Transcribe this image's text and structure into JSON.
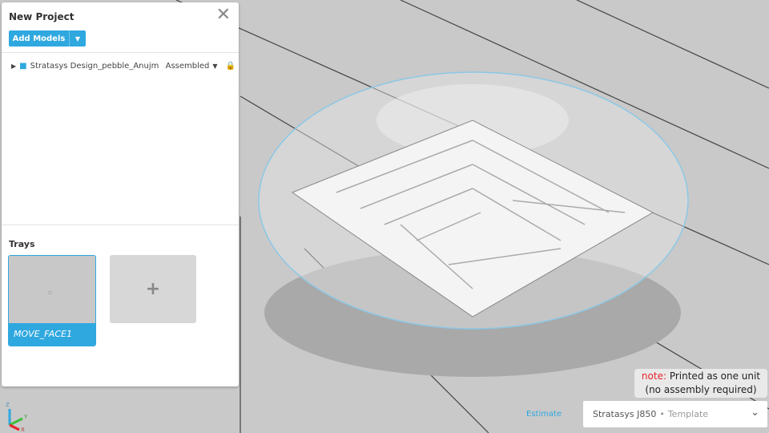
{
  "panel": {
    "title": "New Project",
    "add_models_label": "Add Models",
    "dropdown_icon": "caret-down-icon",
    "close_icon": "close-icon"
  },
  "model": {
    "name": "Stratasys Design_pebble_Anujmalvi...",
    "mode": "Assembled",
    "icons": [
      "expand-caret-icon",
      "assembly-cube-icon",
      "caret-down-icon",
      "lock-icon"
    ]
  },
  "trays": {
    "heading": "Trays",
    "items": [
      {
        "label": "MOVE_FACE1",
        "selected": true
      }
    ],
    "add_symbol": "+"
  },
  "note": {
    "prefix": "note:",
    "line1": "Printed as one unit",
    "line2": "(no assembly required)",
    "prefix_color": "#e8232a"
  },
  "footer": {
    "estimate": "Estimate",
    "printer": "Stratasys J850",
    "separator": "•",
    "template": "Template"
  },
  "axes": {
    "z": "Z",
    "y": "Y",
    "x": "X"
  },
  "colors": {
    "accent": "#2fa8df",
    "viewport": "#c9c9c9"
  }
}
